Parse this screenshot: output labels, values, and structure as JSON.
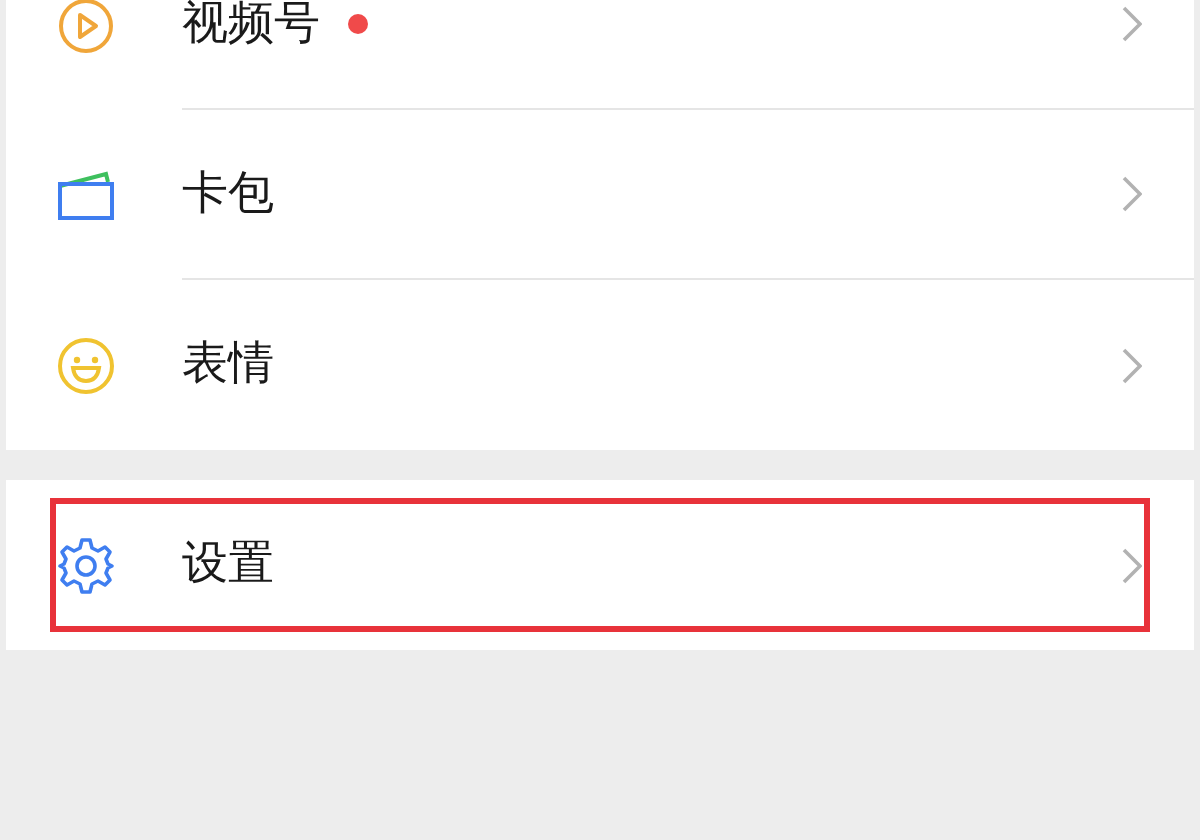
{
  "groups": [
    {
      "items": [
        {
          "kind": "channels",
          "label": "视频号",
          "badge_dot": true,
          "highlighted": false
        },
        {
          "kind": "cards",
          "label": "卡包",
          "badge_dot": false,
          "highlighted": false
        },
        {
          "kind": "stickers",
          "label": "表情",
          "badge_dot": false,
          "highlighted": false
        }
      ]
    },
    {
      "items": [
        {
          "kind": "settings",
          "label": "设置",
          "badge_dot": false,
          "highlighted": true
        }
      ]
    }
  ]
}
